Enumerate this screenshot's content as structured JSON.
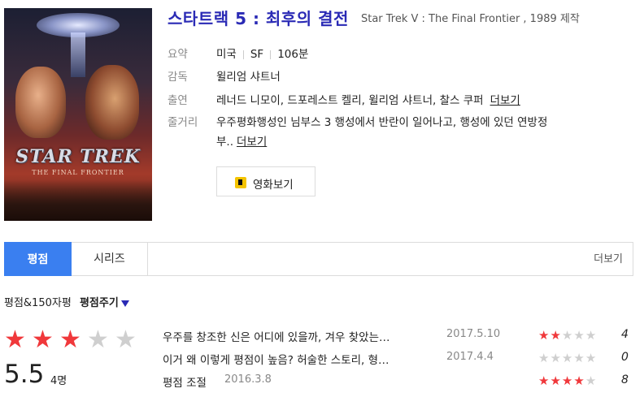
{
  "movie": {
    "title": "스타트랙 5 : 최후의 결전",
    "original_title": "Star Trek V : The Final Frontier , 1989 제작",
    "poster": {
      "logo_text": "STAR TREK",
      "subtitle_text": "THE FINAL FRONTIER"
    }
  },
  "info": {
    "summary_label": "요약",
    "country": "미국",
    "genre": "SF",
    "runtime": "106분",
    "director_label": "감독",
    "director": "윌리엄 샤트너",
    "cast_label": "출연",
    "cast": "레너드 니모이, 드포레스트 켈리, 윌리엄 샤트너, 찰스 쿠퍼",
    "cast_more": "더보기",
    "plot_label": "줄거리",
    "plot_line1": "우주평화행성인 님부스 3 행성에서 반란이 일어나고, 행성에 있던 연방정",
    "plot_line2": "부..",
    "plot_more": "더보기"
  },
  "watch_button": {
    "label": "영화보기",
    "icon": "play-icon"
  },
  "tabs": {
    "items": [
      {
        "label": "평점",
        "active": true
      },
      {
        "label": "시리즈",
        "active": false
      }
    ],
    "more": "더보기"
  },
  "ratings": {
    "header_label": "평점&150자평",
    "give_label": "평점주기",
    "score": "5.5",
    "stars_on": 3,
    "stars_total": 5,
    "count": "4명",
    "reviews": [
      {
        "text": "우주를 창조한 신은 어디에 있을까, 겨우 찾았는…",
        "date": "2017.5.10",
        "stars_on": 2,
        "rating": "4"
      },
      {
        "text": "이거 왜 이렇게 평점이 높음? 허술한 스토리, 형…",
        "date": "2017.4.4",
        "stars_on": 0,
        "rating": "0"
      },
      {
        "text": "평점 조절",
        "date": "2016.3.8",
        "stars_on": 4,
        "rating": "8"
      }
    ]
  },
  "colors": {
    "title": "#2a2ab5",
    "tab_active": "#3a7ff0",
    "star_on": "#f0383b",
    "star_off": "#cfcfcf",
    "play_icon": "#f5c400"
  }
}
